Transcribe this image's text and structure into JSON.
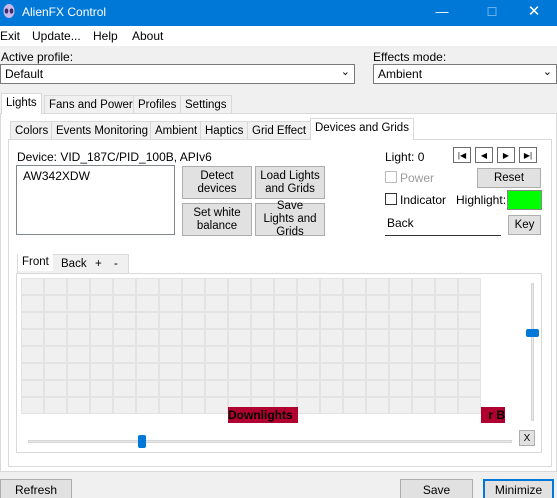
{
  "window": {
    "title": "AlienFX Control"
  },
  "menu": {
    "items": [
      "Exit",
      "Update...",
      "Help",
      "About"
    ]
  },
  "profile": {
    "label": "Active profile:",
    "value": "Default"
  },
  "effects": {
    "label": "Effects mode:",
    "value": "Ambient"
  },
  "main_tabs": [
    "Lights",
    "Fans and Power",
    "Profiles",
    "Settings"
  ],
  "sub_tabs": [
    "Colors",
    "Events Monitoring",
    "Ambient",
    "Haptics",
    "Grid Effect",
    "Devices and Grids"
  ],
  "device": {
    "label": "Device: VID_187C/PID_100B, APIv6",
    "list": [
      "AW342XDW"
    ]
  },
  "buttons": {
    "detect": "Detect devices",
    "load": "Load Lights and Grids",
    "setwhite": "Set white balance",
    "save": "Save Lights and Grids",
    "reset": "Reset",
    "key": "Key",
    "refresh": "Refresh",
    "save_main": "Save",
    "minimize": "Minimize",
    "x": "X"
  },
  "light": {
    "label": "Light: 0",
    "power": "Power",
    "indicator": "Indicator",
    "highlight": "Highlight:",
    "highlight_color": "#00ff00",
    "name": "Back"
  },
  "grid_tabs": [
    "Front",
    "Back",
    "+",
    "-"
  ],
  "grid_labels": {
    "downlights": "Downlights",
    "edge": "r B"
  },
  "colors": {
    "accent": "#0078d7",
    "light_cell": "#b00030"
  }
}
